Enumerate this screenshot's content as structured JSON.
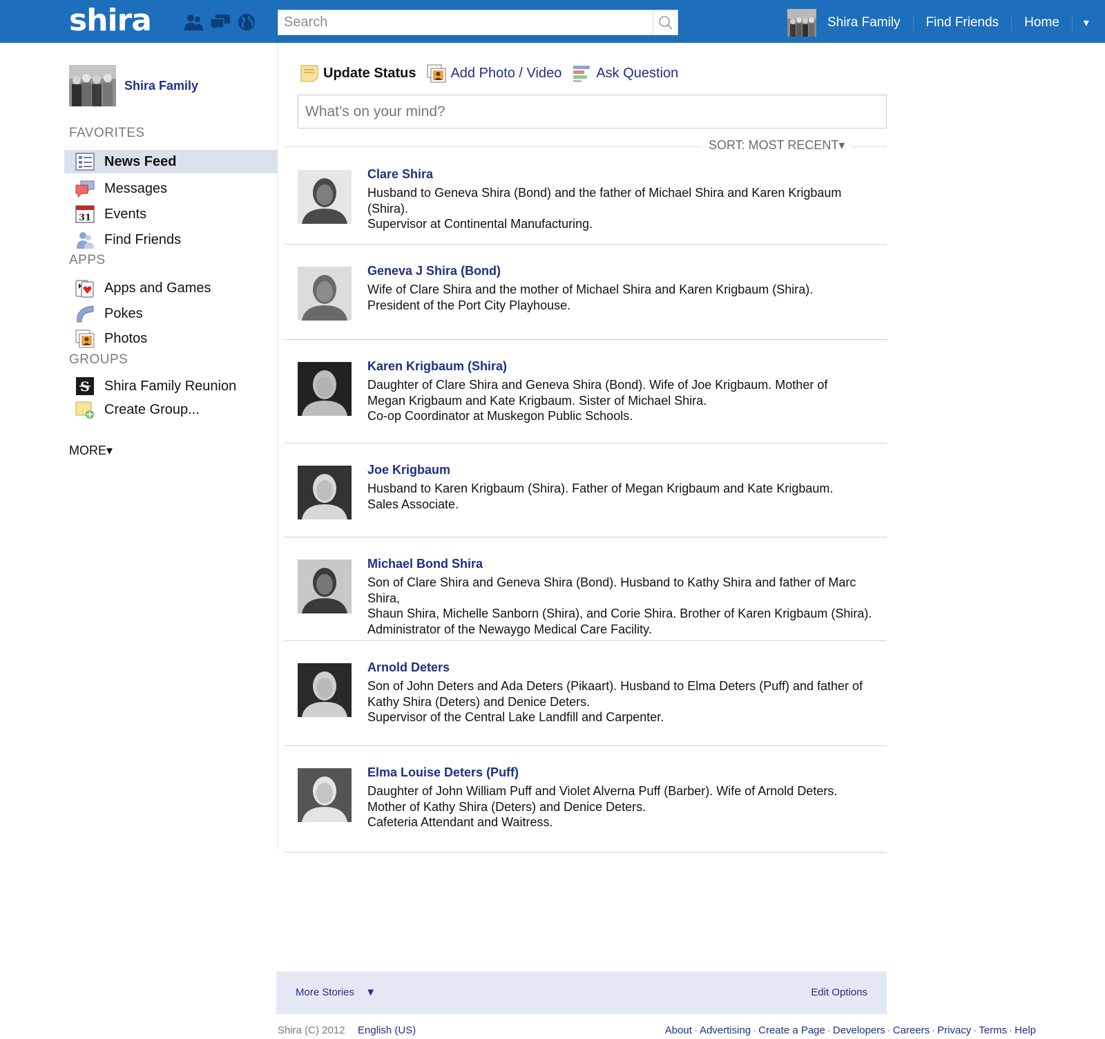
{
  "topbar": {
    "logo": "shira",
    "search_placeholder": "Search",
    "links": [
      "Shira Family",
      "Find Friends",
      "Home"
    ],
    "caret": "▾"
  },
  "sidebar": {
    "profile_name": "Shira Family",
    "sections": {
      "favorites": "FAVORITES",
      "apps": "APPS",
      "groups": "GROUPS"
    },
    "favorites": [
      {
        "label": "News Feed",
        "icon": "news-feed-icon"
      },
      {
        "label": "Messages",
        "icon": "messages-icon"
      },
      {
        "label": "Events",
        "icon": "calendar-icon"
      },
      {
        "label": "Find Friends",
        "icon": "friends-icon"
      }
    ],
    "apps": [
      {
        "label": "Apps and Games",
        "icon": "cards-icon"
      },
      {
        "label": "Pokes",
        "icon": "poke-hand-icon"
      },
      {
        "label": "Photos",
        "icon": "photos-icon"
      }
    ],
    "groups": [
      {
        "label": "Shira Family Reunion",
        "icon": "group-logo-icon"
      },
      {
        "label": "Create Group...",
        "icon": "create-group-icon"
      }
    ],
    "calendar_day": "31",
    "group_logo_glyph": "S",
    "more": "MORE▾"
  },
  "composer": {
    "tabs": [
      "Update Status",
      "Add Photo / Video",
      "Ask Question"
    ],
    "placeholder": "What’s on your mind?",
    "sort": "SORT: MOST RECENT▾"
  },
  "stories": [
    {
      "name": "Clare Shira",
      "lines": [
        "Husband to Geneva Shira (Bond) and the father of Michael Shira and Karen Krigbaum (Shira).",
        "Supervisor at Continental Manufacturing."
      ]
    },
    {
      "name": "Geneva J Shira (Bond)",
      "lines": [
        "Wife of Clare Shira and the mother of Michael Shira and Karen Krigbaum (Shira).",
        "President of the Port City Playhouse."
      ]
    },
    {
      "name": "Karen Krigbaum (Shira)",
      "lines": [
        "Daughter of Clare Shira and Geneva Shira (Bond). Wife of Joe Krigbaum. Mother of",
        "Megan Krigbaum and Kate Krigbaum. Sister of Michael Shira.",
        "Co-op Coordinator at Muskegon Public Schools."
      ]
    },
    {
      "name": "Joe Krigbaum",
      "lines": [
        "Husband to Karen Krigbaum (Shira). Father of Megan Krigbaum and Kate Krigbaum.",
        "Sales Associate."
      ]
    },
    {
      "name": "Michael Bond Shira",
      "lines": [
        "Son of Clare Shira and Geneva Shira (Bond). Husband to Kathy Shira and father of Marc Shira,",
        "Shaun Shira, Michelle Sanborn (Shira), and Corie Shira. Brother of Karen Krigbaum (Shira).",
        "Administrator of the Newaygo Medical Care Facility."
      ]
    },
    {
      "name": "Arnold Deters",
      "lines": [
        "Son of John Deters and Ada Deters (Pikaart). Husband to Elma Deters (Puff) and father of",
        "Kathy Shira (Deters) and Denice Deters.",
        "Supervisor of the Central Lake Landfill and Carpenter."
      ]
    },
    {
      "name": "Elma Louise Deters (Puff)",
      "lines": [
        "Daughter of John William Puff and Violet Alverna Puff (Barber). Wife of Arnold Deters.",
        "Mother of Kathy Shira (Deters) and Denice Deters.",
        "Cafeteria Attendant and Waitress."
      ]
    }
  ],
  "footer": {
    "more_stories": "More Stories",
    "more_caret": "▼",
    "edit_options": "Edit Options",
    "copyright": "Shira (C) 2012",
    "language": "English (US)",
    "links": [
      "About",
      "Advertising",
      "Create a Page",
      "Developers",
      "Careers",
      "Privacy",
      "Terms",
      "Help"
    ],
    "separator": "·"
  },
  "colors": {
    "topbar": "#1d6fbb",
    "link": "#1f2f85",
    "active_nav": "#d9e1ec",
    "more_bar": "#e4e8f4"
  }
}
